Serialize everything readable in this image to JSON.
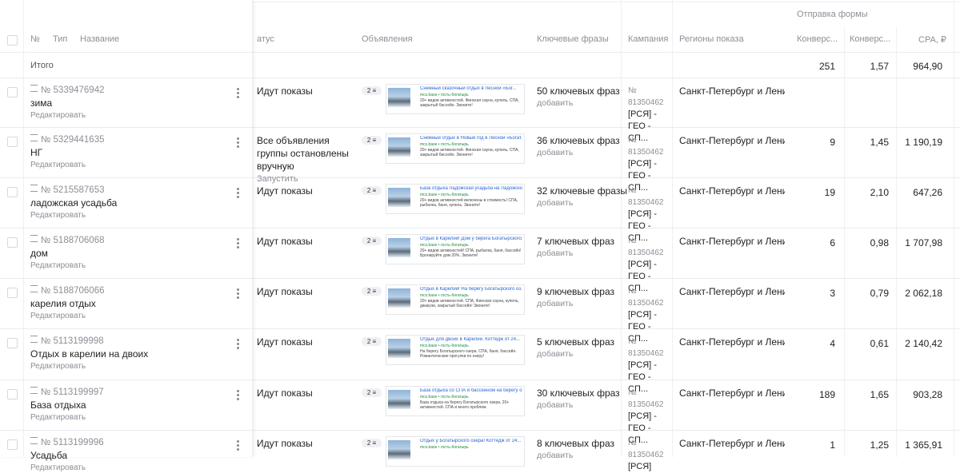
{
  "header": {
    "group_title": "Отправка формы",
    "col_no": "№",
    "col_type": "Тип",
    "col_name": "Название",
    "col_status": "атус",
    "col_ads": "Объявления",
    "col_keywords": "Ключевые фразы",
    "col_campaign": "Кампания",
    "col_regions": "Регионы показа",
    "col_conv1": "Конверс...",
    "col_conv2": "Конверс...",
    "col_cpa": "CPA, ₽"
  },
  "total": {
    "label": "Итого",
    "conv": "251",
    "rate": "1,57",
    "cpa": "964,90"
  },
  "rows": [
    {
      "id": "№ 5339476942",
      "name": "зима",
      "edit": "Редактировать",
      "status": "Идут показы",
      "action": "",
      "pill": "2",
      "ad_title": "Снежный сказочный отдых в Лесной «Бог...",
      "ad_url": "mcs.base • гость-бoгатырь",
      "ad_text": "20+ видов активностей. Финская сауна, купель, СПА, закрытый бассейн. Звоните!",
      "kw": "50 ключевых фраз",
      "kw_add": "добавить",
      "camp_id": "№ 81350462",
      "camp_name": "[РСЯ] - ГЕО - СП...",
      "region": "Санкт-Петербург и Ленингр",
      "conv": "",
      "rate": "",
      "cpa": ""
    },
    {
      "id": "№ 5329441635",
      "name": "НГ",
      "edit": "Редактировать",
      "status": "Все объявления группы остановлены вручную",
      "action": "Запустить",
      "pill": "2",
      "ad_title": "Снежный отдых в Новый год в Лесной «Богат...",
      "ad_url": "mcs.base • гость-бoгатырь",
      "ad_text": "20+ видов активностей. Финская сауна, купель, СПА, закрытый бассейн. Звоните!",
      "kw": "36 ключевых фраз",
      "kw_add": "добавить",
      "camp_id": "№ 81350462",
      "camp_name": "[РСЯ] - ГЕО - СП...",
      "region": "Санкт-Петербург и Ленингр",
      "conv": "9",
      "rate": "1,45",
      "cpa": "1 190,19"
    },
    {
      "id": "№ 5215587653",
      "name": "ладожская усадьба",
      "edit": "Редактировать",
      "status": "Идут показы",
      "action": "",
      "pill": "2",
      "ad_title": "База отдыха Ладожская усадьба на Ладожском озере...",
      "ad_url": "mcs.base • гость-бoгатырь",
      "ad_text": "20+ видов активностей включены в стоимость! СПА, рыбалка, баня, купель. Звоните!",
      "kw": "32 ключевые фразы",
      "kw_add": "добавить",
      "camp_id": "№ 81350462",
      "camp_name": "[РСЯ] - ГЕО - СП...",
      "region": "Санкт-Петербург и Ленингр",
      "conv": "19",
      "rate": "2,10",
      "cpa": "647,26"
    },
    {
      "id": "№ 5188706068",
      "name": "дом",
      "edit": "Редактировать",
      "status": "Идут показы",
      "action": "",
      "pill": "2",
      "ad_title": "Отдых в Карелии! Дом у берега Богатырского...",
      "ad_url": "mcs.base • гость-бoгатырь",
      "ad_text": "20+ видов активностей! СПА, рыбалка, баня, бассейн! Бронируйте дом 20%. Звоните!",
      "kw": "7 ключевых фраз",
      "kw_add": "добавить",
      "camp_id": "№ 81350462",
      "camp_name": "[РСЯ] - ГЕО - СП...",
      "region": "Санкт-Петербург и Ленингр",
      "conv": "6",
      "rate": "0,98",
      "cpa": "1 707,98"
    },
    {
      "id": "№ 5188706066",
      "name": "карелия отдых",
      "edit": "Редактировать",
      "status": "Идут показы",
      "action": "",
      "pill": "2",
      "ad_title": "Отдых в Карелии! На берегу Богатырского оз...",
      "ad_url": "mcs.base • гость-бoгатырь",
      "ad_text": "20+ видов активностей. СПА, Финская сауна, купель, джакузи, закрытый бассейн! Звоните!",
      "kw": "9 ключевых фраз",
      "kw_add": "добавить",
      "camp_id": "№ 81350462",
      "camp_name": "[РСЯ] - ГЕО - СП...",
      "region": "Санкт-Петербург и Ленингр",
      "conv": "3",
      "rate": "0,79",
      "cpa": "2 062,18"
    },
    {
      "id": "№ 5113199998",
      "name": "Отдых в карелии на двоих",
      "edit": "Редактировать",
      "status": "Идут показы",
      "action": "",
      "pill": "2",
      "ad_title": "Отдых для двоих в Карелии. Коттедж от 24...",
      "ad_url": "mcs.base • гость-бoгатырь",
      "ad_text": "На берегу Богатырского озера. СПА, баня, бассейн. Романтические прогулки по озеру!",
      "kw": "5 ключевых фраз",
      "kw_add": "добавить",
      "camp_id": "№ 81350462",
      "camp_name": "[РСЯ] - ГЕО - СП...",
      "region": "Санкт-Петербург и Ленингр",
      "conv": "4",
      "rate": "0,61",
      "cpa": "2 140,42"
    },
    {
      "id": "№ 5113199997",
      "name": "База отдыха",
      "edit": "Редактировать",
      "status": "Идут показы",
      "action": "",
      "pill": "2",
      "ad_title": "База отдыха со СПА и бассейном на берегу о...",
      "ad_url": "mcs.base • гость-бoгатырь",
      "ad_text": "База отдыха на берегу Богатырского озера. 20+ активностей. СПА и много проблем.",
      "kw": "30 ключевых фраз",
      "kw_add": "добавить",
      "camp_id": "№ 81350462",
      "camp_name": "[РСЯ] - ГЕО - СП...",
      "region": "Санкт-Петербург и Ленингр",
      "conv": "189",
      "rate": "1,65",
      "cpa": "903,28"
    },
    {
      "id": "№ 5113199996",
      "name": "Усадьба",
      "edit": "Редактировать",
      "status": "Идут показы",
      "action": "",
      "pill": "2",
      "ad_title": "Отдых у Богатырского озера! Коттедж от 24...",
      "ad_url": "mcs.base • гость-бoгатырь",
      "ad_text": "",
      "kw": "8 ключевых фраз",
      "kw_add": "добавить",
      "camp_id": "№ 81350462",
      "camp_name": "[РСЯ]",
      "region": "Санкт-Петербург и Ленингр",
      "conv": "1",
      "rate": "1,25",
      "cpa": "1 365,91"
    }
  ]
}
